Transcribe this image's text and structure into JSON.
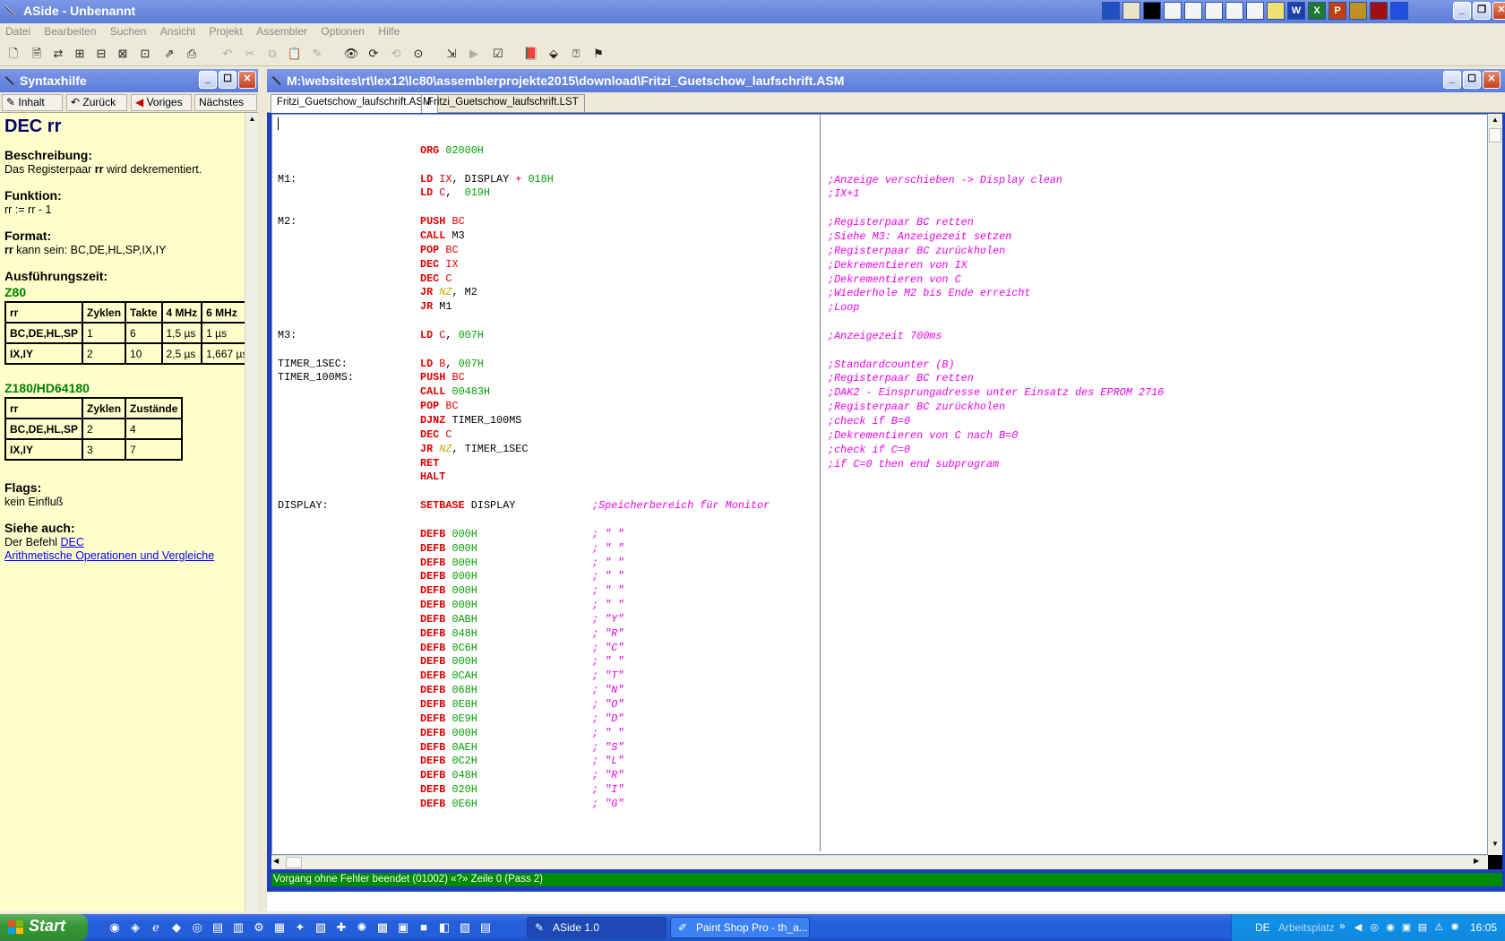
{
  "app": {
    "title": "ASide - Unbenannt"
  },
  "menu": [
    "Datei",
    "Bearbeiten",
    "Suchen",
    "Ansicht",
    "Projekt",
    "Assembler",
    "Optionen",
    "Hilfe"
  ],
  "syntax": {
    "title": "Syntaxhilfe",
    "nav": {
      "inhalt": "Inhalt",
      "zurueck": "Zurück",
      "voriges": "Voriges",
      "naechstes": "Nächstes"
    },
    "heading": "DEC rr",
    "beschreibung_h": "Beschreibung:",
    "beschreibung_pre": "Das Registerpaar ",
    "beschreibung_rr": "rr",
    "beschreibung_post": " wird dekrementiert.",
    "funktion_h": "Funktion:",
    "funktion_t": "rr := rr - 1",
    "format_h": "Format:",
    "format_rr": "rr",
    "format_t": " kann sein: BC,DE,HL,SP,IX,IY",
    "zeit_h": "Ausführungszeit:",
    "z80_h": "Z80",
    "z80_table": {
      "headers": [
        "rr",
        "Zyklen",
        "Takte",
        "4 MHz",
        "6 MHz"
      ],
      "rows": [
        [
          "BC,DE,HL,SP",
          "1",
          "6",
          "1,5 µs",
          "1 µs"
        ],
        [
          "IX,IY",
          "2",
          "10",
          "2,5 µs",
          "1,667 µs"
        ]
      ]
    },
    "z180_h": "Z180/HD64180",
    "z180_table": {
      "headers": [
        "rr",
        "Zyklen",
        "Zustände"
      ],
      "rows": [
        [
          "BC,DE,HL,SP",
          "2",
          "4"
        ],
        [
          "IX,IY",
          "3",
          "7"
        ]
      ]
    },
    "flags_h": "Flags:",
    "flags_t": "kein Einfluß",
    "siehe_h": "Siehe auch:",
    "siehe_pre": "Der Befehl ",
    "siehe_link1": "DEC",
    "siehe_link2": "Arithmetische Operationen und Vergleiche"
  },
  "editor": {
    "title": "M:\\websites\\rt\\lex12\\lc80\\assemblerprojekte2015\\download\\Fritzi_Guetschow_laufschrift.ASM",
    "tabs": [
      "Fritzi_Guetschow_laufschrift.ASM",
      "Fritzi_Guetschow_laufschrift.LST"
    ],
    "status": "Vorgang ohne Fehler beendet (01002) «?» Zeile 0 (Pass 2)",
    "comments": [
      ";Anzeige verschieben -> Display clean",
      ";IX+1",
      "",
      ";Registerpaar BC retten",
      ";Siehe M3: Anzeigezeit setzen",
      ";Registerpaar BC zurückholen",
      ";Dekrementieren von IX",
      ";Dekrementieren von C",
      ";Wiederhole M2 bis Ende erreicht",
      ";Loop",
      "",
      ";Anzeigezeit 700ms",
      "",
      ";Standardcounter (B)",
      ";Registerpaar BC retten",
      ";DAK2 - Einsprungadresse unter Einsatz des EPROM 2716",
      ";Registerpaar BC zurückholen",
      ";check if B=0",
      ";Dekrementieren von C nach B=0",
      ";check if C=0",
      ";if C=0 then end subprogram"
    ],
    "code": [
      {
        "row": 1,
        "mn": "ORG",
        "ops": [
          [
            "n",
            "02000H"
          ]
        ]
      },
      {
        "row": 3,
        "label": "M1:",
        "mn": "LD",
        "ops": [
          [
            "r",
            "IX"
          ],
          [
            "t",
            ", DISPLAY "
          ],
          [
            "p",
            "+"
          ],
          [
            "t",
            " "
          ],
          [
            "n",
            "018H"
          ]
        ]
      },
      {
        "row": 4,
        "mn": "LD",
        "ops": [
          [
            "r",
            "C"
          ],
          [
            "t",
            ",  "
          ],
          [
            "n",
            "019H"
          ]
        ]
      },
      {
        "row": 6,
        "label": "M2:",
        "mn": "PUSH",
        "ops": [
          [
            "r",
            "BC"
          ]
        ]
      },
      {
        "row": 7,
        "mn": "CALL",
        "ops": [
          [
            "t",
            "M3"
          ]
        ]
      },
      {
        "row": 8,
        "mn": "POP",
        "ops": [
          [
            "r",
            "BC"
          ]
        ]
      },
      {
        "row": 9,
        "mn": "DEC",
        "ops": [
          [
            "r",
            "IX"
          ]
        ]
      },
      {
        "row": 10,
        "mn": "DEC",
        "ops": [
          [
            "r",
            "C"
          ]
        ]
      },
      {
        "row": 11,
        "mn": "JR",
        "ops": [
          [
            "c",
            "NZ"
          ],
          [
            "t",
            ", M2"
          ]
        ]
      },
      {
        "row": 12,
        "mn": "JR",
        "ops": [
          [
            "t",
            "M1"
          ]
        ]
      },
      {
        "row": 14,
        "label": "M3:",
        "mn": "LD",
        "ops": [
          [
            "r",
            "C"
          ],
          [
            "t",
            ", "
          ],
          [
            "n",
            "007H"
          ]
        ]
      },
      {
        "row": 16,
        "label": "TIMER_1SEC:",
        "mn": "LD",
        "ops": [
          [
            "r",
            "B"
          ],
          [
            "t",
            ", "
          ],
          [
            "n",
            "007H"
          ]
        ]
      },
      {
        "row": 17,
        "label": "TIMER_100MS:",
        "mn": "PUSH",
        "ops": [
          [
            "r",
            "BC"
          ]
        ]
      },
      {
        "row": 18,
        "mn": "CALL",
        "ops": [
          [
            "n",
            "00483H"
          ]
        ]
      },
      {
        "row": 19,
        "mn": "POP",
        "ops": [
          [
            "r",
            "BC"
          ]
        ]
      },
      {
        "row": 20,
        "mn": "DJNZ",
        "ops": [
          [
            "t",
            "TIMER_100MS"
          ]
        ]
      },
      {
        "row": 21,
        "mn": "DEC",
        "ops": [
          [
            "r",
            "C"
          ]
        ]
      },
      {
        "row": 22,
        "mn": "JR",
        "ops": [
          [
            "c",
            "NZ"
          ],
          [
            "t",
            ", TIMER_1SEC"
          ]
        ]
      },
      {
        "row": 23,
        "mn": "RET",
        "ops": []
      },
      {
        "row": 24,
        "mn": "HALT",
        "ops": []
      },
      {
        "row": 26,
        "label": "DISPLAY:",
        "mn": "SETBASE",
        "ops": [
          [
            "t",
            "DISPLAY"
          ]
        ],
        "cmt": ";Speicherbereich für Monitor"
      },
      {
        "row": 28,
        "mn": "DEFB",
        "ops": [
          [
            "n",
            "000H"
          ]
        ],
        "cmt": "; \" \""
      },
      {
        "row": 29,
        "mn": "DEFB",
        "ops": [
          [
            "n",
            "000H"
          ]
        ],
        "cmt": "; \" \""
      },
      {
        "row": 30,
        "mn": "DEFB",
        "ops": [
          [
            "n",
            "000H"
          ]
        ],
        "cmt": "; \" \""
      },
      {
        "row": 31,
        "mn": "DEFB",
        "ops": [
          [
            "n",
            "000H"
          ]
        ],
        "cmt": "; \" \""
      },
      {
        "row": 32,
        "mn": "DEFB",
        "ops": [
          [
            "n",
            "000H"
          ]
        ],
        "cmt": "; \" \""
      },
      {
        "row": 33,
        "mn": "DEFB",
        "ops": [
          [
            "n",
            "000H"
          ]
        ],
        "cmt": "; \" \""
      },
      {
        "row": 34,
        "mn": "DEFB",
        "ops": [
          [
            "n",
            "0ABH"
          ]
        ],
        "cmt": "; \"Y\""
      },
      {
        "row": 35,
        "mn": "DEFB",
        "ops": [
          [
            "n",
            "048H"
          ]
        ],
        "cmt": "; \"R\""
      },
      {
        "row": 36,
        "mn": "DEFB",
        "ops": [
          [
            "n",
            "0C6H"
          ]
        ],
        "cmt": "; \"C\""
      },
      {
        "row": 37,
        "mn": "DEFB",
        "ops": [
          [
            "n",
            "000H"
          ]
        ],
        "cmt": "; \" \""
      },
      {
        "row": 38,
        "mn": "DEFB",
        "ops": [
          [
            "n",
            "0CAH"
          ]
        ],
        "cmt": "; \"T\""
      },
      {
        "row": 39,
        "mn": "DEFB",
        "ops": [
          [
            "n",
            "068H"
          ]
        ],
        "cmt": "; \"N\""
      },
      {
        "row": 40,
        "mn": "DEFB",
        "ops": [
          [
            "n",
            "0E8H"
          ]
        ],
        "cmt": "; \"O\""
      },
      {
        "row": 41,
        "mn": "DEFB",
        "ops": [
          [
            "n",
            "0E9H"
          ]
        ],
        "cmt": "; \"D\""
      },
      {
        "row": 42,
        "mn": "DEFB",
        "ops": [
          [
            "n",
            "000H"
          ]
        ],
        "cmt": "; \" \""
      },
      {
        "row": 43,
        "mn": "DEFB",
        "ops": [
          [
            "n",
            "0AEH"
          ]
        ],
        "cmt": "; \"S\""
      },
      {
        "row": 44,
        "mn": "DEFB",
        "ops": [
          [
            "n",
            "0C2H"
          ]
        ],
        "cmt": "; \"L\""
      },
      {
        "row": 45,
        "mn": "DEFB",
        "ops": [
          [
            "n",
            "048H"
          ]
        ],
        "cmt": "; \"R\""
      },
      {
        "row": 46,
        "mn": "DEFB",
        "ops": [
          [
            "n",
            "020H"
          ]
        ],
        "cmt": "; \"I\""
      },
      {
        "row": 47,
        "mn": "DEFB",
        "ops": [
          [
            "n",
            "0E6H"
          ]
        ],
        "cmt": "; \"G\""
      }
    ]
  },
  "taskbar": {
    "start": "Start",
    "tasks": [
      "ASide 1.0",
      "Paint Shop Pro - th_a..."
    ],
    "lang": "DE",
    "arbeitsplatz": "Arbeitsplatz",
    "time": "16:05"
  },
  "colors": {
    "titlebar": "#5c7ed8",
    "status_green": "#008a00",
    "help_bg": "#ffffcc",
    "mnemonic": "#e00000",
    "number": "#00a000",
    "comment": "#ee00ee"
  }
}
